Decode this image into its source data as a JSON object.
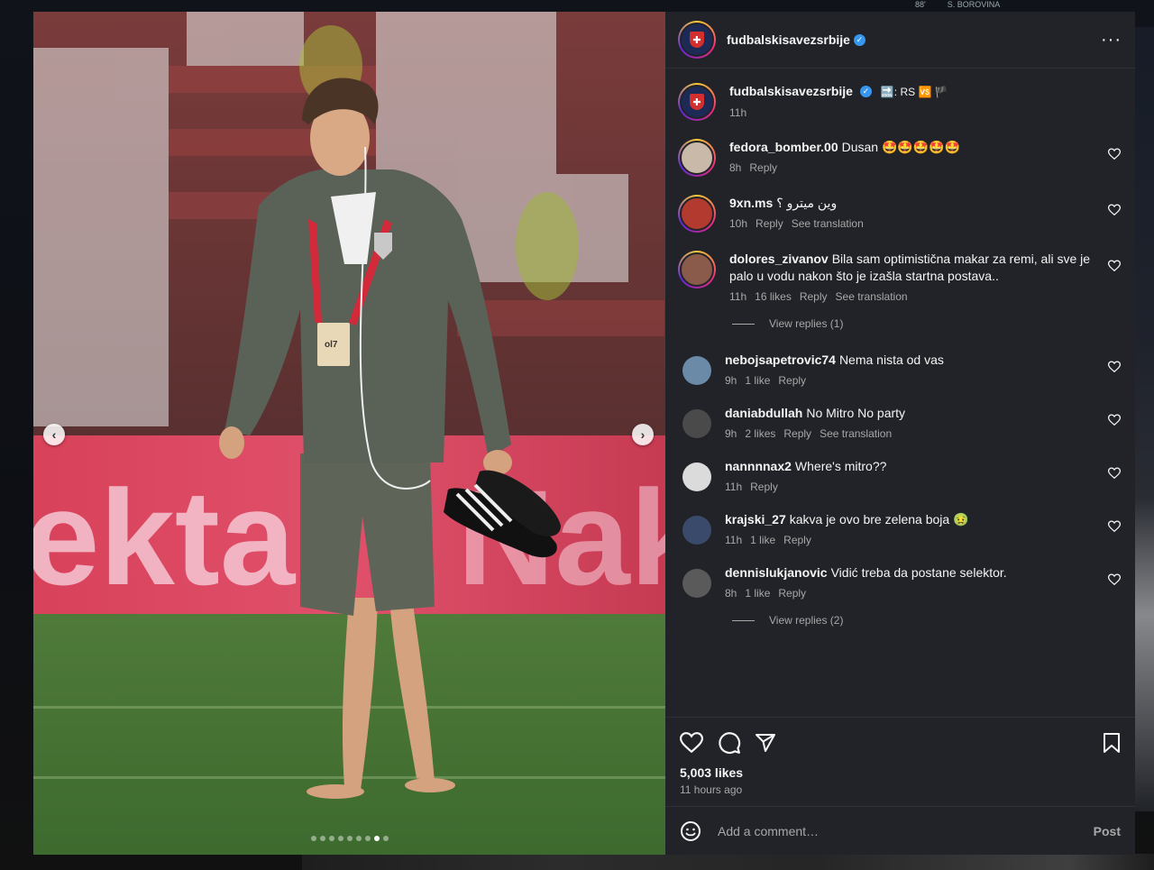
{
  "background": {
    "score_text": "88'",
    "score_player": "S. BOROVINA"
  },
  "post": {
    "username": "fudbalskisavezsrbije",
    "verified": true,
    "more_icon": "more-horizontal-icon",
    "carousel": {
      "slide_count": 9,
      "active_slide": 7
    },
    "caption": {
      "username": "fudbalskisavezsrbije",
      "text": "🔜: RS 🆚 🏴",
      "time": "11h"
    }
  },
  "comments": [
    {
      "user": "fedora_bomber.00",
      "text": "Dusan 🤩🤩🤩🤩🤩",
      "time": "8h",
      "likes": "",
      "reply": "Reply",
      "translate": "",
      "avatar_color": "#c9b9a8",
      "ring": true
    },
    {
      "user": "9xn.ms",
      "text": "وين ميترو ؟",
      "time": "10h",
      "likes": "",
      "reply": "Reply",
      "translate": "See translation",
      "avatar_color": "#b33a2e",
      "ring": true
    },
    {
      "user": "dolores_zivanov",
      "text": "Bila sam optimistična makar za remi, ali sve je palo u vodu nakon što je izašla startna postava..",
      "time": "11h",
      "likes": "16 likes",
      "reply": "Reply",
      "translate": "See translation",
      "avatar_color": "#8a5a4a",
      "ring": true,
      "view_replies": "View replies (1)"
    },
    {
      "user": "nebojsapetrovic74",
      "text": "Nema nista od vas",
      "time": "9h",
      "likes": "1 like",
      "reply": "Reply",
      "translate": "",
      "avatar_color": "#6a8aa8",
      "ring": false
    },
    {
      "user": "daniabdullah",
      "text": "No Mitro No party",
      "time": "9h",
      "likes": "2 likes",
      "reply": "Reply",
      "translate": "See translation",
      "avatar_color": "#4a4a4a",
      "ring": false
    },
    {
      "user": "nannnnax2",
      "text": "Where's mitro??",
      "time": "11h",
      "likes": "",
      "reply": "Reply",
      "translate": "",
      "avatar_color": "#dbdbdb",
      "ring": false
    },
    {
      "user": "krajski_27",
      "text": "kakva je ovo bre zelena boja 🤢",
      "time": "11h",
      "likes": "1 like",
      "reply": "Reply",
      "translate": "",
      "avatar_color": "#3a4a6a",
      "ring": false
    },
    {
      "user": "dennislukjanovic",
      "text": "Vidić treba da postane selektor.",
      "time": "8h",
      "likes": "1 like",
      "reply": "Reply",
      "translate": "",
      "avatar_color": "#5a5a5a",
      "ring": false,
      "view_replies": "View replies (2)"
    }
  ],
  "actions": {
    "like_icon": "heart-icon",
    "comment_icon": "comment-icon",
    "share_icon": "send-icon",
    "save_icon": "bookmark-icon",
    "likes_count": "5,003 likes",
    "time_ago": "11 hours ago"
  },
  "add_comment": {
    "emoji_icon": "emoji-icon",
    "placeholder": "Add a comment…",
    "post_label": "Post"
  },
  "photo": {
    "badge_text": "ol7",
    "banner_text": "ektar"
  }
}
